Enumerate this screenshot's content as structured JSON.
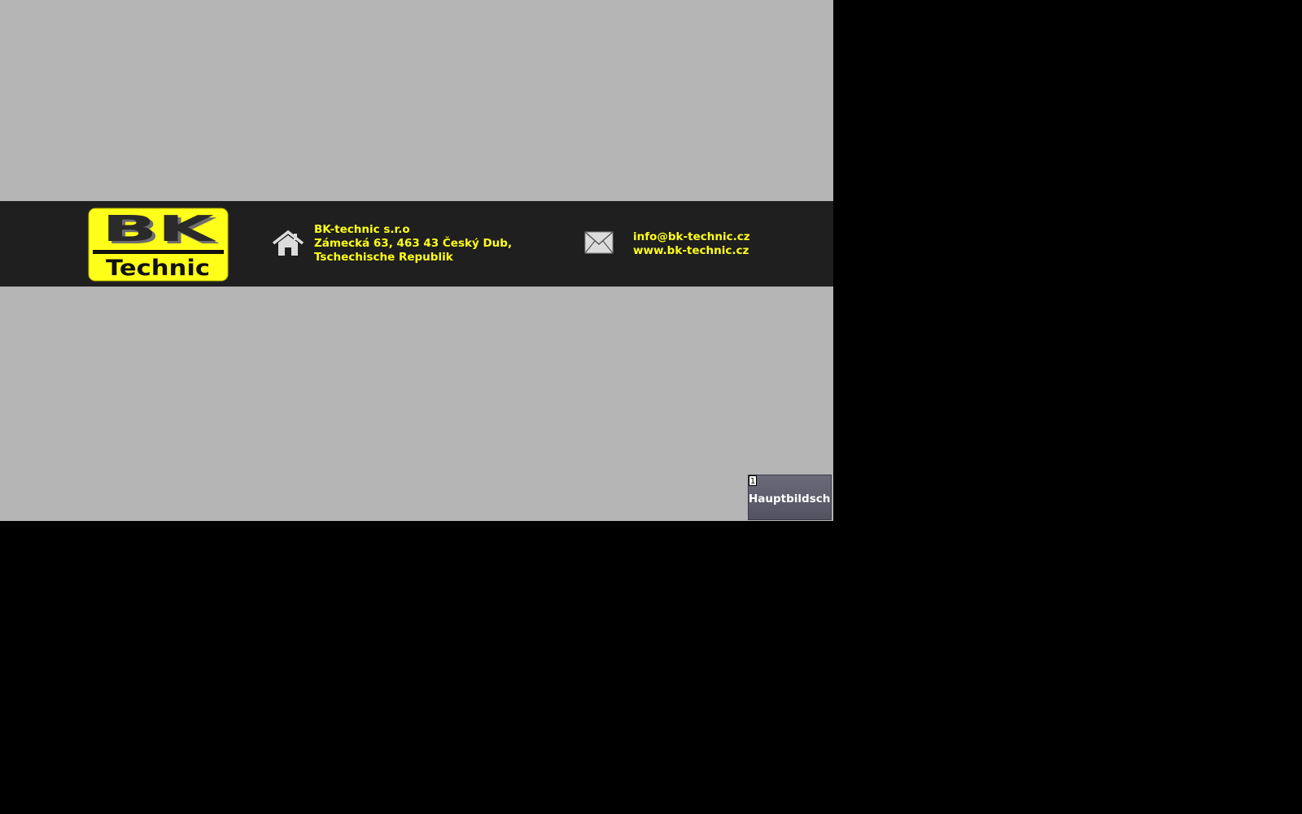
{
  "logo": {
    "line1": "BK",
    "line2": "Technic"
  },
  "address": {
    "company": "BK-technic s.r.o",
    "street": "Zámecká 63, 463 43 Český Dub,",
    "country": "Tschechische Republik"
  },
  "contact": {
    "email": "info@bk-technic.cz",
    "website": "www.bk-technic.cz"
  },
  "navigation": {
    "main_screen_label": "Hauptbildschim",
    "main_screen_hotkey": "1"
  },
  "icons": {
    "home": "home-icon",
    "mail": "mail-icon"
  },
  "colors": {
    "background": "#b5b5b5",
    "banner": "#1f1f1f",
    "accent_text": "#ffff1a",
    "logo_yellow": "#ffff1a",
    "button": "#5e5e6c"
  }
}
